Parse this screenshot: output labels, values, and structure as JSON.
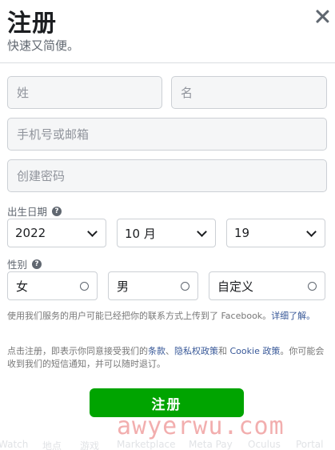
{
  "header": {
    "title": "注册",
    "subtitle": "快速又简便。"
  },
  "form": {
    "last_name_placeholder": "姓",
    "first_name_placeholder": "名",
    "contact_placeholder": "手机号或邮箱",
    "password_placeholder": "创建密码",
    "birthday_label": "出生日期",
    "birthday": {
      "year": "2022",
      "month": "10 月",
      "day": "19"
    },
    "gender_label": "性别",
    "genders": [
      "女",
      "男",
      "自定义"
    ],
    "contact_upload_note": "使用我们服务的用户可能已经把你的联系方式上传到了 Facebook。",
    "contact_upload_link": "详细了解。",
    "terms_prefix": "点击注册，即表示你同意接受我们的",
    "terms_link": "条款",
    "terms_sep": "、",
    "privacy_link": "隐私权政策",
    "terms_and": "和 ",
    "cookie_link": "Cookie 政策",
    "terms_suffix": "。你可能会收到我们的短信通知，并可以随时退订。",
    "submit_label": "注册"
  },
  "footer": {
    "links": [
      "Watch",
      "地点",
      "游戏",
      "Marketplace",
      "Meta Pay",
      "Oculus",
      "Portal"
    ]
  },
  "watermark": "awyerwu.com",
  "colors": {
    "accent": "#00a400",
    "link": "#385898"
  }
}
